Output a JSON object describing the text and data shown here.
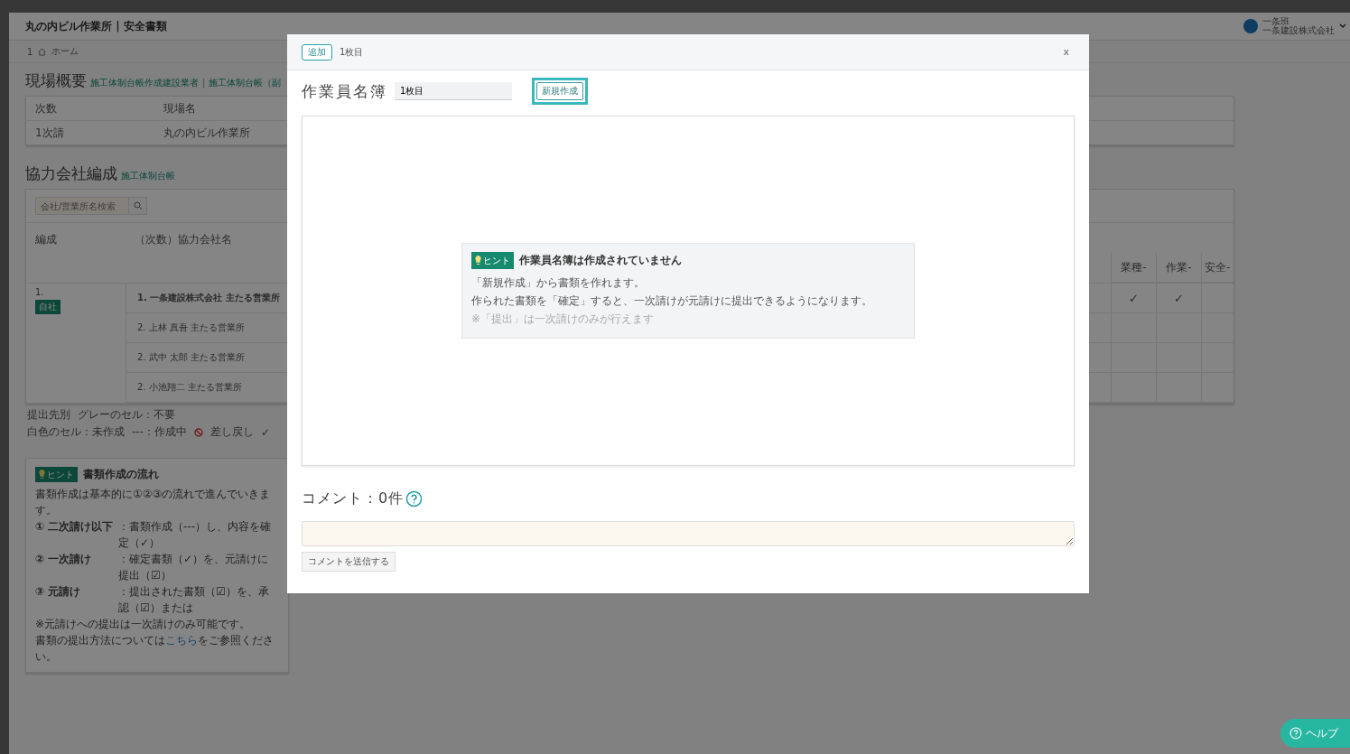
{
  "header": {
    "title": "丸の内ビル作業所 | 安全書類",
    "user": {
      "name": "一条班",
      "company": "一条建設株式会社"
    }
  },
  "breadcrumb": {
    "number": "1",
    "home": "ホーム"
  },
  "site_summary": {
    "heading": "現場概要",
    "links": [
      "施工体制台帳作成建設業者",
      "施工体制台帳（副"
    ],
    "separator": "|",
    "columns": [
      "次数",
      "現場名"
    ],
    "rows": [
      [
        "1次請",
        "丸の内ビル作業所"
      ]
    ]
  },
  "partners": {
    "heading": "協力会社編成",
    "links": [
      "施工体制台帳"
    ],
    "search": {
      "placeholder": "会社/営業所名検索"
    },
    "columns": [
      "編成",
      "（次数）協力会社名"
    ],
    "doc_columns": [
      "業種-",
      "作業-",
      "安全-"
    ],
    "group": {
      "number": "1.",
      "badge": "自社"
    },
    "rows": [
      {
        "name": "1. 一条建設株式会社 主たる営業所",
        "bold": true,
        "cells": [
          "✓",
          "✓",
          ""
        ]
      },
      {
        "name": "2. 上林 真吾 主たる営業所",
        "bold": false,
        "cells": [
          "",
          "",
          ""
        ]
      },
      {
        "name": "2. 武中 太郎 主たる営業所",
        "bold": false,
        "cells": [
          "",
          "",
          ""
        ]
      },
      {
        "name": "2. 小池翔二 主たる営業所",
        "bold": false,
        "cells": [
          "",
          "",
          ""
        ]
      }
    ],
    "legend": {
      "items": [
        "提出先別",
        "グレーのセル：不要",
        "白色のセル：未作成",
        "---：作成中"
      ],
      "returned": "差し戻し",
      "done": "✓"
    }
  },
  "flow_hint": {
    "badge": "ヒント",
    "title": "書類作成の流れ",
    "intro": "書類作成は基本的に①②③の流れで進んでいきます。",
    "steps": [
      {
        "label": "① 二次請け以下",
        "text": "：書類作成（---）し、内容を確定（✓）"
      },
      {
        "label": "② 一次請け",
        "text": "：確定書類（✓）を、元請けに提出（☑）"
      },
      {
        "label": "③ 元請け",
        "text": "：提出された書類（☑）を、承認（☑）または"
      }
    ],
    "note": "※元請けへの提出は一次請けのみ可能です。",
    "link_line": {
      "before": "書類の提出方法については",
      "link": "こちら",
      "after": "をご参照ください。"
    }
  },
  "modal": {
    "tag": "追加",
    "page": "1枚目",
    "close": "x",
    "title": "作業員名簿",
    "name_field": {
      "value": "1枚目"
    },
    "create_button": {
      "label": "新規作成",
      "focused": true
    },
    "hint": {
      "badge": "ヒント",
      "title": "作業員名簿は作成されていません",
      "lines": [
        "「新規作成」から書類を作れます。",
        "作られた書類を「確定」すると、一次請けが元請けに提出できるようになります。"
      ],
      "note": "※「提出」は一次請けのみが行えます"
    },
    "comments": {
      "title": "コメント：0件",
      "send_button": "コメントを送信する"
    }
  },
  "help_button": {
    "label": "ヘルプ"
  }
}
